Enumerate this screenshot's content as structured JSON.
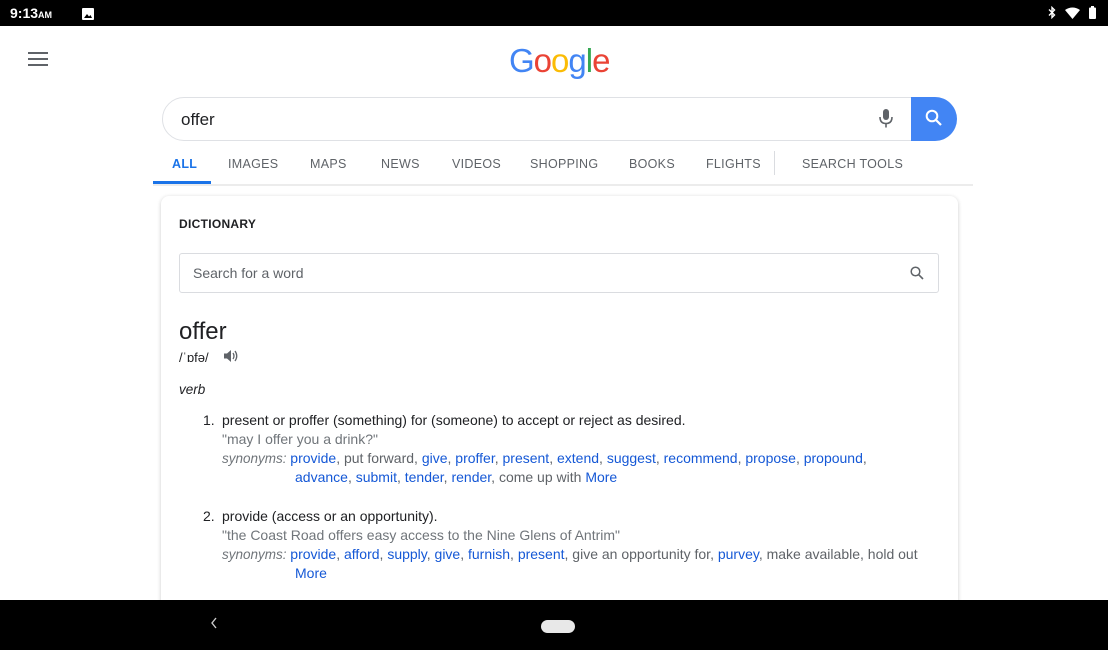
{
  "status_bar": {
    "time": "9:13",
    "ampm": "AM",
    "left_icon": "image-icon",
    "right_icons": [
      "bluetooth-icon",
      "wifi-icon",
      "battery-icon"
    ]
  },
  "header": {
    "logo": [
      "G",
      "o",
      "o",
      "g",
      "l",
      "e"
    ],
    "logo_colors": [
      "#4285F4",
      "#EA4335",
      "#FBBC05",
      "#4285F4",
      "#34A853",
      "#EA4335"
    ],
    "menu_icon": "hamburger-menu-icon"
  },
  "search": {
    "query": "offer",
    "mic_icon": "microphone-icon",
    "search_icon": "search-icon",
    "accent": "#4285f4"
  },
  "tabs": [
    "ALL",
    "IMAGES",
    "MAPS",
    "NEWS",
    "VIDEOS",
    "SHOPPING",
    "BOOKS",
    "FLIGHTS",
    "SEARCH TOOLS"
  ],
  "active_tab": "ALL",
  "dictionary": {
    "title": "DICTIONARY",
    "search_placeholder": "Search for a word",
    "word": "offer",
    "phonetic": "/ˈɒfə/",
    "part_of_speech": "verb",
    "definitions": [
      {
        "number": "1.",
        "text": "present or proffer (something) for (someone) to accept or reject as desired.",
        "example": "\"may I offer you a drink?\"",
        "synonyms_label": "synonyms:",
        "synonyms": [
          {
            "word": "provide",
            "link": true
          },
          {
            "word": "put forward",
            "link": false
          },
          {
            "word": "give",
            "link": true
          },
          {
            "word": "proffer",
            "link": true
          },
          {
            "word": "present",
            "link": true
          },
          {
            "word": "extend",
            "link": true
          },
          {
            "word": "suggest",
            "link": true
          },
          {
            "word": "recommend",
            "link": true
          },
          {
            "word": "propose",
            "link": true
          },
          {
            "word": "propound",
            "link": true
          },
          {
            "word": "advance",
            "link": true
          },
          {
            "word": "submit",
            "link": true
          },
          {
            "word": "tender",
            "link": true
          },
          {
            "word": "render",
            "link": true
          },
          {
            "word": "come up with",
            "link": false
          }
        ],
        "more": "More"
      },
      {
        "number": "2.",
        "text": "provide (access or an opportunity).",
        "example": "\"the Coast Road offers easy access to the Nine Glens of Antrim\"",
        "synonyms_label": "synonyms:",
        "synonyms": [
          {
            "word": "provide",
            "link": true
          },
          {
            "word": "afford",
            "link": true
          },
          {
            "word": "supply",
            "link": true
          },
          {
            "word": "give",
            "link": true
          },
          {
            "word": "furnish",
            "link": true
          },
          {
            "word": "present",
            "link": true
          },
          {
            "word": "give an opportunity for",
            "link": false
          },
          {
            "word": "purvey",
            "link": true
          },
          {
            "word": "make available",
            "link": false
          },
          {
            "word": "hold out",
            "link": false
          }
        ],
        "more": "More"
      }
    ]
  },
  "nav_bar": {
    "back_icon": "back-chevron-icon",
    "home_icon": "home-pill-icon"
  }
}
